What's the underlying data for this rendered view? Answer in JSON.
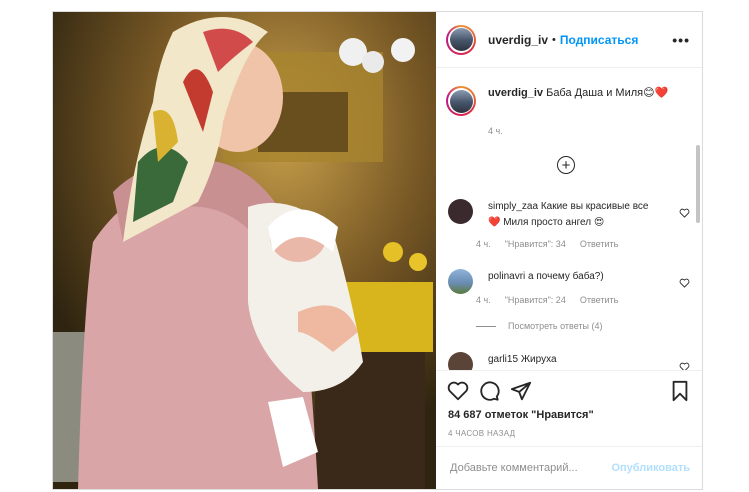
{
  "header": {
    "username": "uverdig_iv",
    "separator": "•",
    "follow_label": "Подписаться",
    "more_label": "•••"
  },
  "caption": {
    "username": "uverdig_iv",
    "text": "Баба Даша и Миля😊❤️",
    "time": "4 ч."
  },
  "load_more_label": "+",
  "comments": [
    {
      "username": "simply_zaa",
      "text": "Какие вы красивые все❤️ Миля просто ангел 😍",
      "time": "4 ч.",
      "likes": "\"Нравится\": 34",
      "reply": "Ответить",
      "avatar_color": "#3a2a2e"
    },
    {
      "username": "polinavri",
      "text": "а почему баба?)",
      "time": "4 ч.",
      "likes": "\"Нравится\": 24",
      "reply": "Ответить",
      "view_replies": "Посмотреть ответы (4)",
      "avatar_color": "#6b8db5"
    },
    {
      "username": "garli15",
      "text": "Жируха",
      "avatar_color": "#5a4438"
    }
  ],
  "footer": {
    "likes_text": "84 687 отметок \"Нравится\"",
    "time_text": "4 ЧАСОВ НАЗАД",
    "comment_placeholder": "Добавьте комментарий...",
    "publish_label": "Опубликовать"
  },
  "colors": {
    "accent": "#0095f6",
    "publish_disabled": "#b2dffc",
    "meta_gray": "#8e8e8e",
    "heart_red": "#ed4956"
  },
  "icons": {
    "like": "heart-icon",
    "comment": "comment-bubble-icon",
    "share": "paper-plane-icon",
    "save": "bookmark-icon"
  }
}
